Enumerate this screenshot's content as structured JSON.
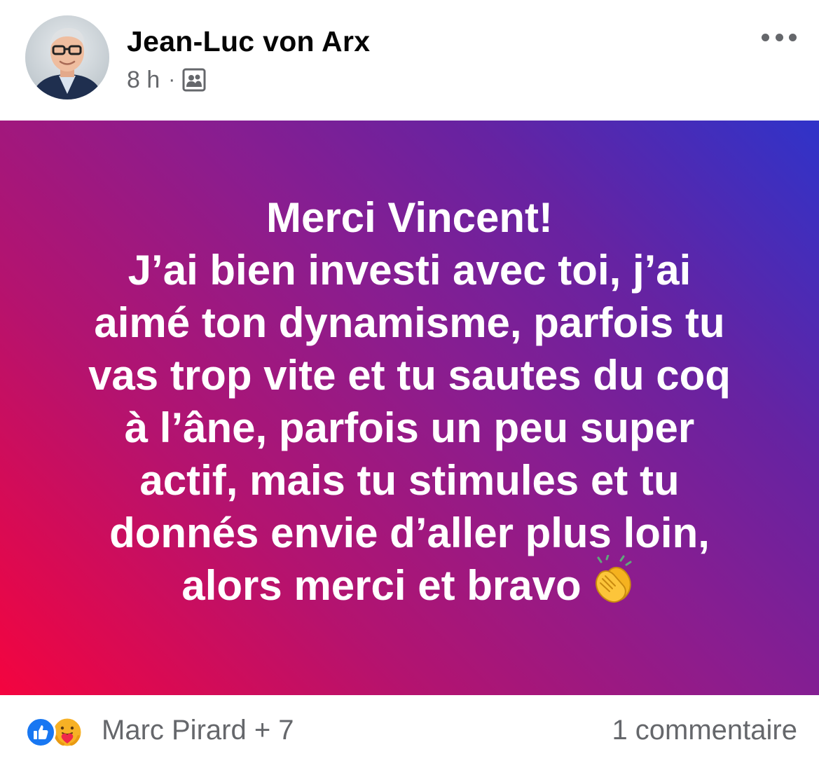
{
  "post": {
    "author": "Jean-Luc von Arx",
    "time": "8 h",
    "separator": "·",
    "audience_icon": "friends-audience-icon",
    "more_icon": "more-options-icon",
    "status_lines": [
      "Merci Vincent!",
      "J’ai bien investi avec toi, j’ai",
      "aimé ton dynamisme, parfois tu",
      "vas trop vite et tu sautes du coq",
      "à l’âne, parfois un peu super",
      "actif, mais tu stimules et tu",
      "donnés envie d’aller plus loin,",
      "alors merci et bravo"
    ],
    "status_emoji": "clapping-hands-emoji",
    "gradient_colors": [
      "#f4043f",
      "#b4136f",
      "#8a1d8f",
      "#6623a2",
      "#2f33c9"
    ]
  },
  "footer": {
    "reaction_icons": [
      "like-reaction-icon",
      "care-reaction-icon"
    ],
    "reactors": "Marc Pirard + 7",
    "comments": "1 commentaire"
  },
  "colors": {
    "like_blue": "#1877f2",
    "secondary_text": "#65676b",
    "primary_text": "#050505"
  }
}
